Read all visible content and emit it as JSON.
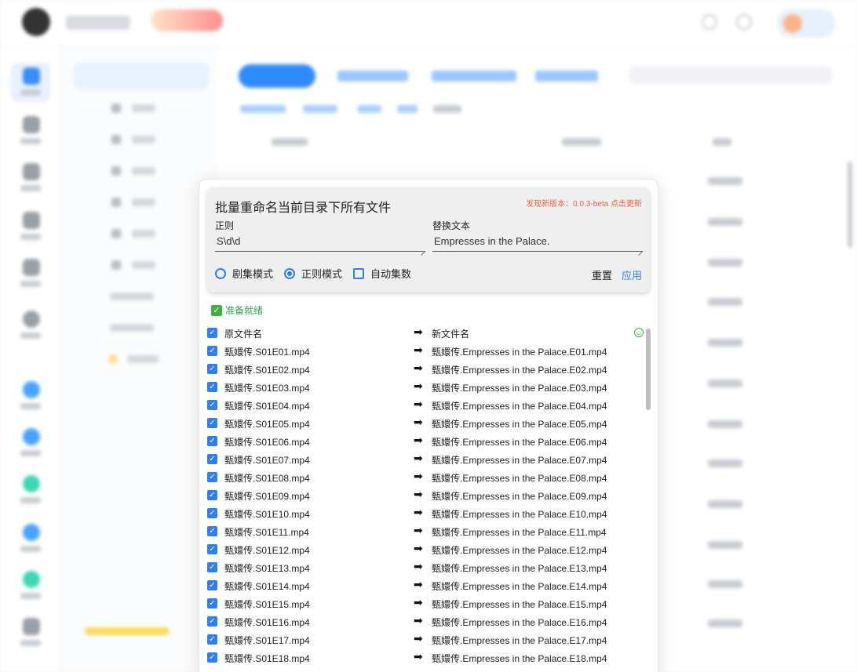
{
  "dialog": {
    "title": "批量重命名当前目录下所有文件",
    "update_notice": "发现新版本：0.0.3-beta 点击更新",
    "regex_label": "正则",
    "regex_value": "S\\d\\d",
    "replace_label": "替换文本",
    "replace_value": "Empresses in the Palace.",
    "mode_episode": "剧集模式",
    "mode_regex": "正则模式",
    "auto_episode": "自动集数",
    "reset": "重置",
    "apply": "应用",
    "status": "准备就绪",
    "header_original": "原文件名",
    "header_new": "新文件名",
    "arrow": "➡"
  },
  "files": [
    {
      "original": "甄嬛传.S01E01.mp4",
      "renamed": "甄嬛传.Empresses in the Palace.E01.mp4"
    },
    {
      "original": "甄嬛传.S01E02.mp4",
      "renamed": "甄嬛传.Empresses in the Palace.E02.mp4"
    },
    {
      "original": "甄嬛传.S01E03.mp4",
      "renamed": "甄嬛传.Empresses in the Palace.E03.mp4"
    },
    {
      "original": "甄嬛传.S01E04.mp4",
      "renamed": "甄嬛传.Empresses in the Palace.E04.mp4"
    },
    {
      "original": "甄嬛传.S01E05.mp4",
      "renamed": "甄嬛传.Empresses in the Palace.E05.mp4"
    },
    {
      "original": "甄嬛传.S01E06.mp4",
      "renamed": "甄嬛传.Empresses in the Palace.E06.mp4"
    },
    {
      "original": "甄嬛传.S01E07.mp4",
      "renamed": "甄嬛传.Empresses in the Palace.E07.mp4"
    },
    {
      "original": "甄嬛传.S01E08.mp4",
      "renamed": "甄嬛传.Empresses in the Palace.E08.mp4"
    },
    {
      "original": "甄嬛传.S01E09.mp4",
      "renamed": "甄嬛传.Empresses in the Palace.E09.mp4"
    },
    {
      "original": "甄嬛传.S01E10.mp4",
      "renamed": "甄嬛传.Empresses in the Palace.E10.mp4"
    },
    {
      "original": "甄嬛传.S01E11.mp4",
      "renamed": "甄嬛传.Empresses in the Palace.E11.mp4"
    },
    {
      "original": "甄嬛传.S01E12.mp4",
      "renamed": "甄嬛传.Empresses in the Palace.E12.mp4"
    },
    {
      "original": "甄嬛传.S01E13.mp4",
      "renamed": "甄嬛传.Empresses in the Palace.E13.mp4"
    },
    {
      "original": "甄嬛传.S01E14.mp4",
      "renamed": "甄嬛传.Empresses in the Palace.E14.mp4"
    },
    {
      "original": "甄嬛传.S01E15.mp4",
      "renamed": "甄嬛传.Empresses in the Palace.E15.mp4"
    },
    {
      "original": "甄嬛传.S01E16.mp4",
      "renamed": "甄嬛传.Empresses in the Palace.E16.mp4"
    },
    {
      "original": "甄嬛传.S01E17.mp4",
      "renamed": "甄嬛传.Empresses in the Palace.E17.mp4"
    },
    {
      "original": "甄嬛传.S01E18.mp4",
      "renamed": "甄嬛传.Empresses in the Palace.E18.mp4"
    }
  ]
}
